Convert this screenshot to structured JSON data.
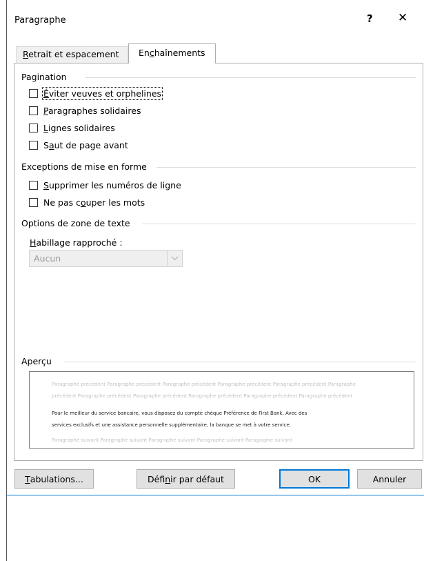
{
  "dialog": {
    "title": "Paragraphe",
    "help_label": "?",
    "close_label": "✕"
  },
  "tabs": [
    {
      "label_pre": "",
      "label_key": "R",
      "label_post": "etrait et espacement",
      "active": false
    },
    {
      "label_pre": "En",
      "label_key": "c",
      "label_post": "haînements",
      "active": true
    }
  ],
  "pagination": {
    "heading": "Pagination",
    "options": [
      {
        "pre": "",
        "key": "É",
        "post": "viter veuves et orphelines",
        "checked": false,
        "focused": true
      },
      {
        "pre": "",
        "key": "P",
        "post": "aragraphes solidaires",
        "checked": false
      },
      {
        "pre": "",
        "key": "L",
        "post": "ignes solidaires",
        "checked": false
      },
      {
        "pre": "S",
        "key": "a",
        "post": "ut de page avant",
        "checked": false
      }
    ]
  },
  "exceptions": {
    "heading": "Exceptions de mise en forme",
    "options": [
      {
        "pre": "",
        "key": "S",
        "post": "upprimer les numéros de ligne",
        "checked": false
      },
      {
        "pre": "Ne pas c",
        "key": "o",
        "post": "uper les mots",
        "checked": false
      }
    ]
  },
  "textbox_options": {
    "heading": "Options de zone de texte",
    "wrap_label_key": "H",
    "wrap_label_post": "abillage rapproché :",
    "wrap_value": "Aucun",
    "arrow_icon": "chevron-down-icon"
  },
  "preview": {
    "heading": "Aperçu",
    "prev_line1": "Paragraphe précédent Paragraphe précédent Paragraphe précédent Paragraphe précédent Paragraphe précédent Paragraphe",
    "prev_line2": "précédent Paragraphe précédent Paragraphe précédent Paragraphe précédent Paragraphe précédent Paragraphe précédent",
    "main_line1": "Pour le meilleur du service bancaire, vous disposez du compte chèque Préférence de First Bank. Avec des",
    "main_line2": "services exclusifs et une assistance personnelle supplémentaire, la banque se met à votre service.",
    "next_line1": "Paragraphe suivant Paragraphe suivant Paragraphe suivant Paragraphe suivant Paragraphe suivant"
  },
  "buttons": {
    "tabs_key": "T",
    "tabs_post": "abulations...",
    "default_pre": "Défi",
    "default_key": "n",
    "default_post": "ir par défaut",
    "ok": "OK",
    "cancel": "Annuler"
  },
  "colors": {
    "accent": "#0078d7"
  }
}
